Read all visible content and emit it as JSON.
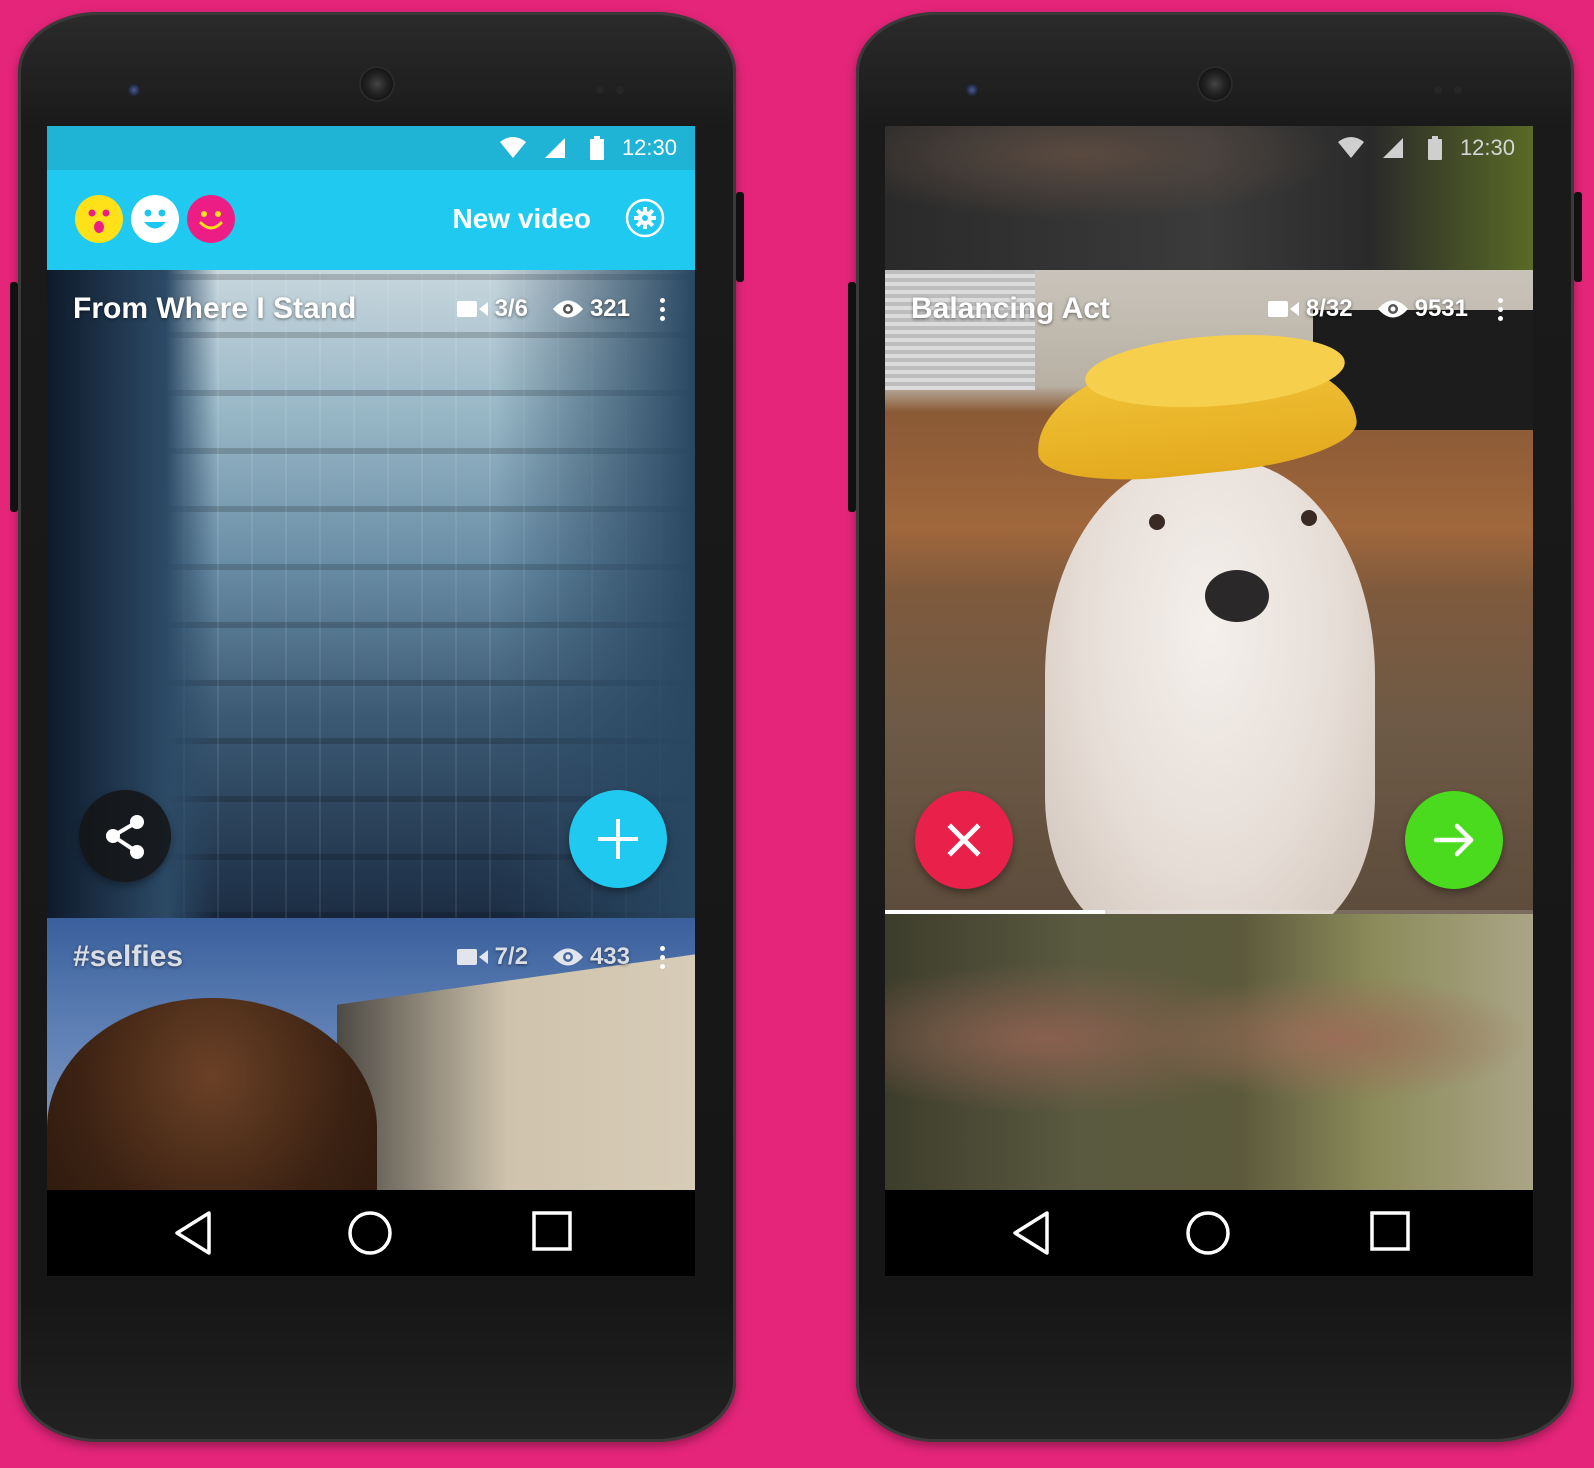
{
  "colors": {
    "background": "#e5257a",
    "accent_blue": "#20c9ef",
    "reject_red": "#e8204a",
    "accept_green": "#4bdb1e",
    "emoji_yellow": "#ffe11a",
    "emoji_cyan": "#1cc6ef",
    "emoji_pink": "#ec1e86"
  },
  "left_phone": {
    "status": {
      "time": "12:30",
      "icons": [
        "wifi-icon",
        "signal-icon",
        "battery-icon"
      ]
    },
    "appbar": {
      "faces": [
        "surprised-face-icon",
        "happy-face-icon",
        "smile-face-icon"
      ],
      "new_video_label": "New video",
      "settings_icon": "gear-icon"
    },
    "cards": [
      {
        "title": "From Where I Stand",
        "clips": "3/6",
        "views": "321",
        "icons": [
          "video-camera-icon",
          "eye-icon",
          "more-vert-icon"
        ]
      },
      {
        "title": "#selfies",
        "clips": "7/2",
        "views": "433",
        "icons": [
          "video-camera-icon",
          "eye-icon",
          "more-vert-icon"
        ]
      }
    ],
    "actions": {
      "share_icon": "share-icon",
      "add_icon": "plus-icon"
    },
    "nav": [
      "back-icon",
      "home-icon",
      "recents-icon"
    ]
  },
  "right_phone": {
    "status": {
      "time": "12:30",
      "icons": [
        "wifi-icon",
        "signal-icon",
        "battery-icon"
      ]
    },
    "card": {
      "title": "Balancing Act",
      "clips": "8/32",
      "views": "9531",
      "icons": [
        "video-camera-icon",
        "eye-icon",
        "more-vert-icon"
      ]
    },
    "actions": {
      "reject_icon": "close-icon",
      "next_icon": "arrow-right-icon"
    },
    "playback_progress": 0.34,
    "nav": [
      "back-icon",
      "home-icon",
      "recents-icon"
    ]
  }
}
